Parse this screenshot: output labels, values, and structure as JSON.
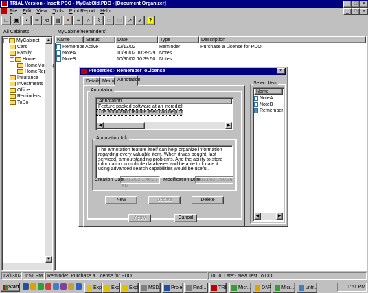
{
  "window": {
    "title": "TRIAL Version - Insoft PDO - MyCabOld.PDO - [Document Organizer]"
  },
  "menu": [
    "File",
    "Edit",
    "View",
    "Tools",
    "Print Report",
    "Help"
  ],
  "toolbar_icons": [
    "new-icon",
    "open-icon",
    "save-icon",
    "cut-icon",
    "copy-icon",
    "paste-icon",
    "delete-icon",
    "properties-icon",
    "find-icon",
    "attach-icon",
    "folder-icon",
    "folder-open-icon",
    "export-icon",
    "import-icon",
    "help-icon"
  ],
  "sidebar": {
    "header": "All Cabinets",
    "tree": [
      {
        "label": "MyCabinet",
        "level": 0,
        "expander": "-"
      },
      {
        "label": "Cars",
        "level": 1,
        "expander": ""
      },
      {
        "label": "Family",
        "level": 1,
        "expander": ""
      },
      {
        "label": "Home",
        "level": 1,
        "expander": "-"
      },
      {
        "label": "HomeMortgage",
        "level": 2,
        "expander": ""
      },
      {
        "label": "HomeRepair",
        "level": 2,
        "expander": ""
      },
      {
        "label": "Insurance",
        "level": 1,
        "expander": ""
      },
      {
        "label": "Investments",
        "level": 1,
        "expander": ""
      },
      {
        "label": "Office",
        "level": 1,
        "expander": ""
      },
      {
        "label": "Reminders",
        "level": 1,
        "expander": ""
      },
      {
        "label": "ToDo",
        "level": 1,
        "expander": ""
      }
    ]
  },
  "list": {
    "path": "MyCabinet\\Reminders\\",
    "columns": [
      "Name",
      "Status",
      "Date",
      "Type",
      "Description"
    ],
    "rows": [
      [
        "Remember...",
        "Active",
        "12/13/02",
        "Reminder",
        "Purchase a License for PDO."
      ],
      [
        "NoteA",
        "",
        "10/30/02 10:39:29...",
        "Notes",
        ""
      ],
      [
        "NoteB",
        "",
        "10/30/02 10:39:50...",
        "Notes",
        ""
      ]
    ]
  },
  "dialog": {
    "title": "Properties:- RememberToLicense",
    "tabs": [
      "Details",
      "Memo",
      "Annotation"
    ],
    "active_tab": "Annotation",
    "annotation_group": "Annotation",
    "annotation_list": {
      "header": "Annotation",
      "items": [
        "Feature packed software at an incredibly low in...",
        "The annotation feature itself can help organize..."
      ]
    },
    "info_group": "Annotation Info",
    "info_text": "The annotation feature itself can help organize information regarding every valuable item.  When it was bought, last serviced, annoutstanding problems.  And the ability to store information in multiple databases and be able to locate it using advanced search capabilities would be useful.",
    "creation_label": "Creation Date",
    "creation_value": "12/13/02 1:46:27 PM",
    "modification_label": "Modification Date",
    "modification_value": "12/13/02 1:50:36 P",
    "buttons": {
      "new": "New",
      "update": "Update",
      "delete": "Delete",
      "apply": "Apply",
      "cancel": "Cancel"
    },
    "select_item": {
      "label": "Select Item",
      "header": "Name",
      "items": [
        "NoteA",
        "NoteB",
        "RememberToL..."
      ]
    }
  },
  "status": {
    "date": "12/13/02",
    "time": "1:51 PM",
    "reminder": "Reminder: Purchase a License for PDO.",
    "todo": "ToDo: Late:- New Test To DO"
  },
  "taskbar": {
    "start": "Start",
    "tasks": [
      "Expl...",
      "Expl...",
      "Expl...",
      "MSD...",
      "Proje...",
      "Find:...",
      "TRI...",
      "Micr...",
      "D:\\P",
      "Micr...",
      "untit..."
    ],
    "clock": "1:51 PM"
  }
}
